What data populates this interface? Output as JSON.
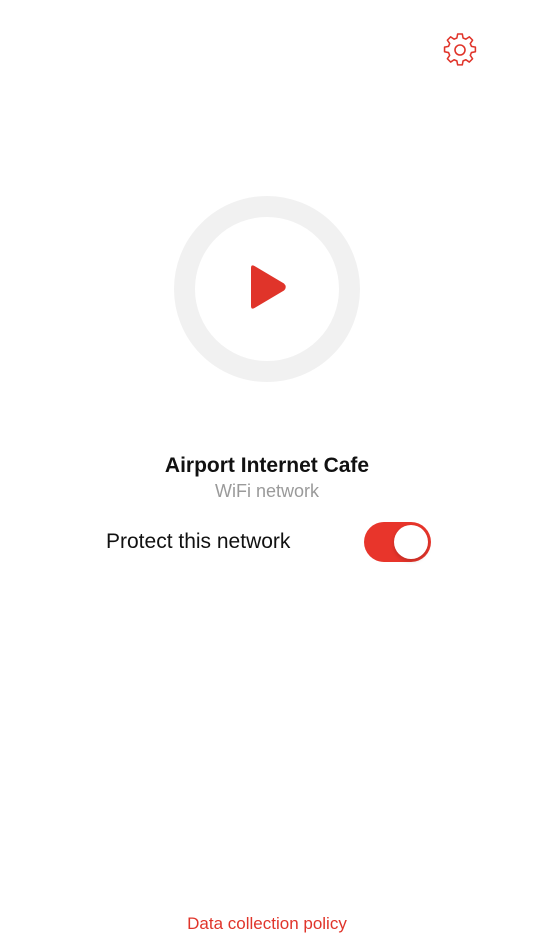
{
  "colors": {
    "accent": "#e0342a",
    "toggle_on": "#e8352b",
    "ring": "#f1f1f1",
    "secondary_text": "#9a9a9a"
  },
  "header": {
    "settings_icon": "gear-icon"
  },
  "main": {
    "play_icon": "play-icon",
    "network_name": "Airport Internet Cafe",
    "network_type": "WiFi network",
    "protect_label": "Protect this network",
    "protect_enabled": true
  },
  "footer": {
    "policy_link": "Data collection policy"
  }
}
